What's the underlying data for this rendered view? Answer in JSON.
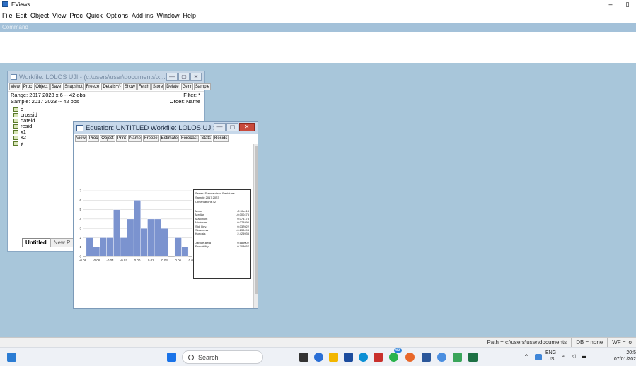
{
  "app": {
    "title": "EViews",
    "win_min": "–",
    "win_max": "▯"
  },
  "menu": [
    "File",
    "Edit",
    "Object",
    "View",
    "Proc",
    "Quick",
    "Options",
    "Add-ins",
    "Window",
    "Help"
  ],
  "command_label": "Command",
  "workfile": {
    "title": "Workfile: LOLOS UJI - (c:\\users\\user\\documents\\x...",
    "toolbar": [
      "View",
      "Proc",
      "Object",
      "Save",
      "Snapshot",
      "Freeze",
      "Details+/-",
      "Show",
      "Fetch",
      "Store",
      "Delete",
      "Genr",
      "Sample"
    ],
    "range": "Range:  2017 2023 x 6  --  42 obs",
    "filter": "Filter: *",
    "sample": "Sample: 2017 2023  --  42 obs",
    "order": "Order: Name",
    "objects": [
      "c",
      "crossid",
      "dateid",
      "resid",
      "x1",
      "x2",
      "y"
    ],
    "tab_active": "Untitled",
    "tab_new": "New P"
  },
  "equation": {
    "title": "Equation: UNTITLED   Workfile: LOLOS UJI::U...",
    "toolbar": [
      "View",
      "Proc",
      "Object",
      "Print",
      "Name",
      "Freeze",
      "Estimate",
      "Forecast",
      "Stats",
      "Resids"
    ]
  },
  "stats_box": {
    "series": "Series: Standardized Residuals",
    "sample": "Sample 2017 2023",
    "obs": "Observations 42",
    "rows": [
      {
        "label": "Mean",
        "value": "-2.30e-18"
      },
      {
        "label": "Median",
        "value": "-0.000475"
      },
      {
        "label": "Maximum",
        "value": "0.074178"
      },
      {
        "label": "Minimum",
        "value": "-0.074890"
      },
      {
        "label": "Std. Dev.",
        "value": "0.037022"
      },
      {
        "label": "Skewness",
        "value": "-0.238498"
      },
      {
        "label": "Kurtosis",
        "value": "2.425935"
      }
    ],
    "jb": {
      "label": "Jarque-Bera",
      "value": "0.689002"
    },
    "prob": {
      "label": "Probability",
      "value": "0.708657"
    }
  },
  "chart_data": {
    "type": "bar",
    "x": [
      -0.07,
      -0.06,
      -0.05,
      -0.04,
      -0.03,
      -0.02,
      -0.01,
      0.0,
      0.01,
      0.02,
      0.03,
      0.04,
      0.05,
      0.06,
      0.07
    ],
    "values": [
      2,
      1,
      2,
      2,
      5,
      2,
      4,
      6,
      3,
      4,
      4,
      3,
      0,
      2,
      1
    ],
    "bin_width": 0.01,
    "xlim": [
      -0.08,
      0.08
    ],
    "ylim": [
      0,
      7
    ],
    "xticks": [
      "-0.08",
      "-0.06",
      "-0.04",
      "-0.02",
      "0.00",
      "0.02",
      "0.04",
      "0.06",
      "0.08"
    ],
    "yticks": [
      0,
      1,
      2,
      3,
      4,
      5,
      6,
      7
    ],
    "bar_color": "#7b93cf",
    "grid": true
  },
  "statusbar": {
    "path": "Path = c:\\users\\user\\documents",
    "db": "DB = none",
    "wf": "WF = lo"
  },
  "taskbar": {
    "search_placeholder": "Search",
    "lang_top": "ENG",
    "lang_bottom": "US",
    "time": "20:5",
    "date": "07/01/202",
    "badge_whatsapp": "63"
  }
}
